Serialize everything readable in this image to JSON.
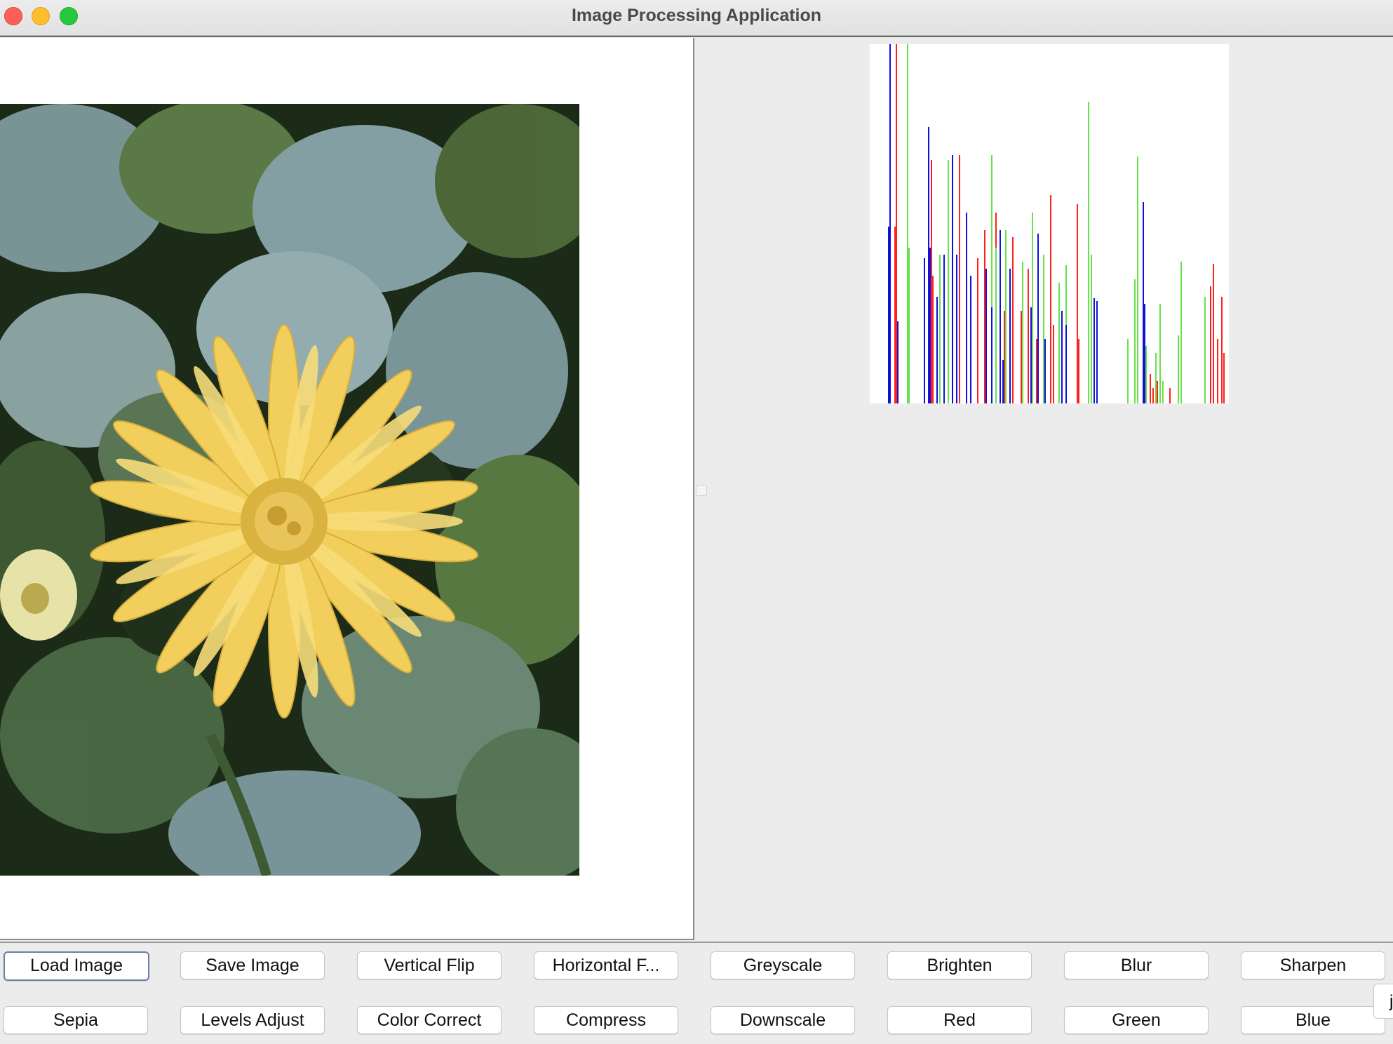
{
  "window": {
    "title": "Image Processing Application"
  },
  "image_view": {
    "content": "Yellow daisy flower among green and blue-grey foliage (posterized)"
  },
  "histogram": {
    "colors": {
      "red": "#ff2020",
      "green": "#66e24a",
      "blue": "#1010dd"
    }
  },
  "toolbar": {
    "row1": [
      "Load Image",
      "Save Image",
      "Vertical Flip",
      "Horizontal F...",
      "Greyscale",
      "Brighten",
      "Blur",
      "Sharpen"
    ],
    "row2": [
      "Sepia",
      "Levels Adjust",
      "Color Correct",
      "Compress",
      "Downscale",
      "Red",
      "Green",
      "Blue"
    ],
    "edge_stub_text": "j"
  }
}
